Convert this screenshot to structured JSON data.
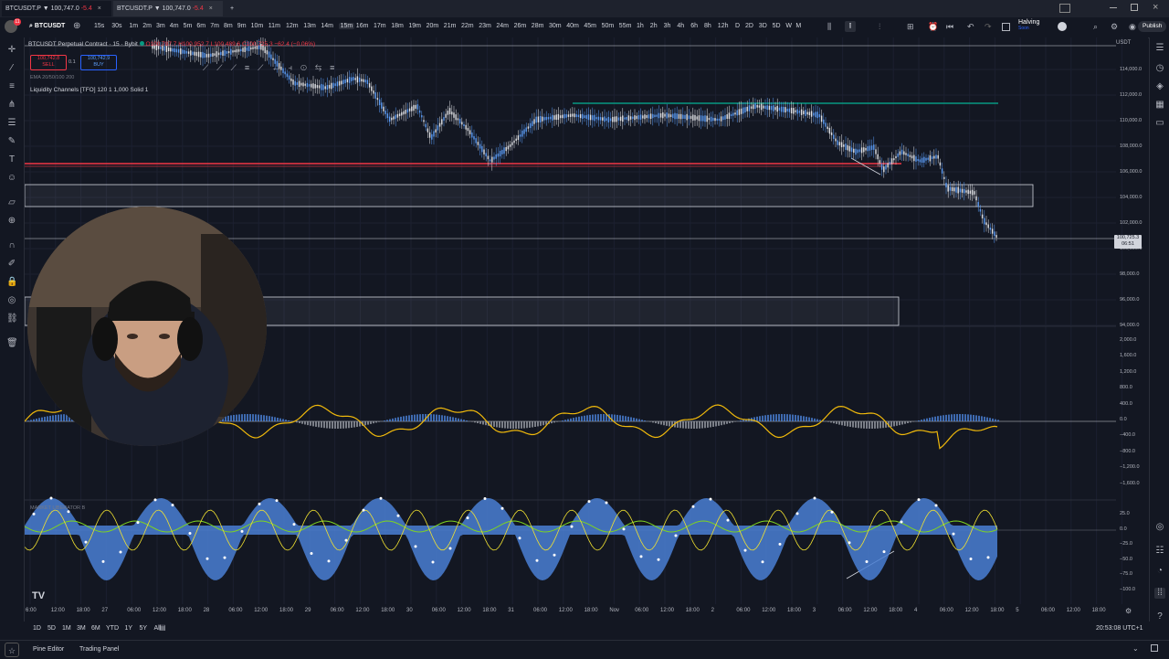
{
  "browser_tabs": [
    {
      "label": "BTCUSDT.P",
      "price": "▼ 100,747.0",
      "change": "-5.4",
      "close": "×"
    },
    {
      "label": "BTCUSDT.P",
      "price": "▼ 100,747.0",
      "change": "-5.4",
      "close": "×"
    },
    {
      "label": "+"
    }
  ],
  "toolbar": {
    "symbol": "BTCUSDT",
    "timeframes": [
      "15s",
      "30s",
      "1m",
      "2m",
      "3m",
      "4m",
      "5m",
      "6m",
      "7m",
      "8m",
      "9m",
      "10m",
      "11m",
      "12m",
      "13m",
      "14m",
      "15m",
      "16m",
      "17m",
      "18m",
      "19m",
      "20m",
      "21m",
      "22m",
      "23m",
      "24m",
      "26m",
      "28m",
      "30m",
      "40m",
      "45m",
      "50m",
      "55m",
      "1h",
      "2h",
      "3h",
      "4h",
      "6h",
      "8h",
      "12h",
      "D",
      "2D",
      "3D",
      "5D",
      "W",
      "M"
    ],
    "active_timeframe": "15m",
    "halving_label": "Halving",
    "halving_sub": "Soon",
    "publish_label": "Publish"
  },
  "legend": {
    "title": "BTCUSDT Perpetual Contract · 15 · Bybit",
    "ohlc": "O100,787.7 H100,952.7 L100,489.6 C100,725.3 −62.4 (−0.06%)",
    "sell_price": "100,742.8",
    "sell_label": "SELL",
    "spread": "0.1",
    "buy_price": "100,742.9",
    "buy_label": "BUY",
    "ema": "EMA 20/50/100 200",
    "liquidity": "Liquidity Channels [TFO] 120 1 1,000 Solid 1"
  },
  "price_axis": {
    "unit": "USDT",
    "labels": [
      "114,000.0",
      "112,000.0",
      "110,000.0",
      "108,000.0",
      "106,000.0",
      "104,000.0",
      "102,000.0",
      "100,000.0",
      "98,000.0",
      "96,000.0",
      "94,000.0"
    ],
    "current_price": "100,725.3",
    "countdown": "06:51"
  },
  "osc1_axis": [
    "2,000.0",
    "1,600.0",
    "1,200.0",
    "800.0",
    "400.0",
    "0.0",
    "−400.0",
    "−800.0",
    "−1,200.0",
    "−1,600.0"
  ],
  "osc2_axis": [
    "25.0",
    "0.0",
    "−25.0",
    "−50.0",
    "−75.0",
    "−100.0"
  ],
  "osc2_title": "MARKET LIBERATOR B",
  "time_axis": [
    "6:00",
    "12:00",
    "18:00",
    "27",
    "06:00",
    "12:00",
    "18:00",
    "28",
    "06:00",
    "12:00",
    "18:00",
    "29",
    "06:00",
    "12:00",
    "18:00",
    "30",
    "06:00",
    "12:00",
    "18:00",
    "31",
    "06:00",
    "12:00",
    "18:00",
    "Nov",
    "06:00",
    "12:00",
    "18:00",
    "2",
    "06:00",
    "12:00",
    "18:00",
    "3",
    "06:00",
    "12:00",
    "18:00",
    "4",
    "06:00",
    "12:00",
    "18:00",
    "5",
    "06:00",
    "12:00",
    "18:00"
  ],
  "bottom_ranges": [
    "1D",
    "5D",
    "1M",
    "3M",
    "6M",
    "YTD",
    "1Y",
    "5Y",
    "All"
  ],
  "clock": "20:53:08 UTC+1",
  "footer": {
    "pine_editor": "Pine Editor",
    "trading_panel": "Trading Panel"
  },
  "colors": {
    "bg": "#131722",
    "up": "#5b9cf6",
    "down": "#e3e4e8",
    "red_level": "#f23645",
    "green_level": "#089981",
    "osc_line": "#f0b90b",
    "histogram": "#4a7fd4"
  }
}
